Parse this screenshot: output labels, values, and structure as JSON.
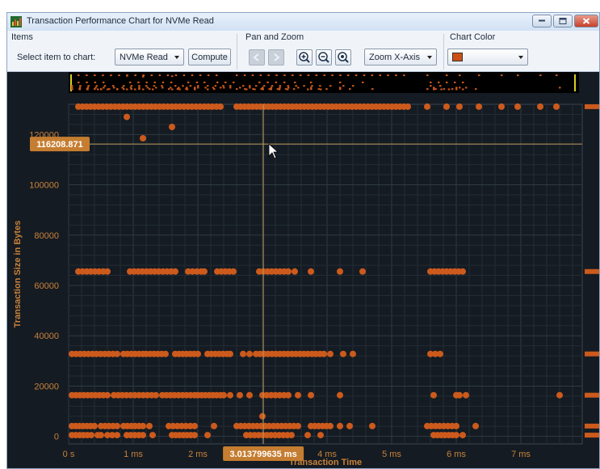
{
  "window": {
    "title": "Transaction Performance Chart for NVMe Read"
  },
  "toolbar": {
    "items_group": "Items",
    "select_label": "Select item to chart:",
    "item_value": "NVMe Read",
    "compute_label": "Compute",
    "panzoom_group": "Pan and Zoom",
    "zoom_axis_value": "Zoom X-Axis",
    "color_group": "Chart Color",
    "color_value": "#cc5016"
  },
  "icons": {
    "pan_left": "pan-left-icon",
    "pan_right": "pan-right-icon",
    "zoom_in": "zoom-in-icon",
    "zoom_out": "zoom-out-icon",
    "zoom_reset": "zoom-reset-icon"
  },
  "colors": {
    "point": "#cc5a1c",
    "axis_text": "#c8823a",
    "background": "#151b22",
    "grid": "#2e3a44",
    "cursor": "#b9985a",
    "tooltip": "#c57d31"
  },
  "chart_data": {
    "type": "scatter",
    "xlabel": "Transaction Time",
    "ylabel": "Transaction Size in Bytes",
    "xlim": [
      0,
      7.95
    ],
    "ylim": [
      -3000,
      132000
    ],
    "x_unit": "ms",
    "x_ticks": [
      0,
      1,
      2,
      3,
      4,
      5,
      6,
      7
    ],
    "x_tick_labels": [
      "0 s",
      "1 ms",
      "2 ms",
      "3 ms",
      "4 ms",
      "5 ms",
      "6 ms",
      "7 ms"
    ],
    "y_ticks": [
      0,
      20000,
      40000,
      60000,
      80000,
      100000,
      120000
    ],
    "y_tick_labels": [
      "0",
      "20000",
      "40000",
      "60000",
      "80000",
      "100000",
      "120000"
    ],
    "grid": true,
    "cursor": {
      "x": 3.013799635,
      "y": 116208.871,
      "x_label": "3.013799635 ms",
      "y_label": "116208.871"
    },
    "series": [
      {
        "bands": [
          {
            "y": 131072,
            "ranges": [
              [
                0.15,
                2.35
              ],
              [
                2.6,
                5.25
              ]
            ],
            "points": [
              5.55,
              5.85,
              6.05,
              6.35,
              6.7,
              6.95,
              7.3,
              7.55
            ]
          },
          {
            "y": 65536,
            "ranges": [
              [
                0.15,
                0.6
              ],
              [
                0.95,
                1.65
              ],
              [
                1.85,
                2.05
              ],
              [
                2.3,
                2.55
              ],
              [
                2.95,
                3.4
              ],
              [
                5.6,
                6.1
              ]
            ],
            "points": [
              2.1,
              3.5,
              3.75,
              4.2,
              4.55
            ]
          },
          {
            "y": 32768,
            "ranges": [
              [
                0.05,
                0.75
              ],
              [
                0.85,
                1.15
              ],
              [
                1.2,
                1.5
              ],
              [
                1.65,
                2.0
              ],
              [
                2.15,
                2.45
              ],
              [
                2.9,
                3.95
              ],
              [
                5.6,
                5.75
              ]
            ],
            "points": [
              2.5,
              2.7,
              2.8,
              4.05,
              4.25,
              4.4
            ]
          },
          {
            "y": 16384,
            "ranges": [
              [
                0.05,
                0.6
              ],
              [
                0.7,
                1.35
              ],
              [
                1.45,
                1.95
              ],
              [
                2.0,
                2.35
              ],
              [
                3.0,
                3.4
              ]
            ],
            "points": [
              2.4,
              2.5,
              2.65,
              2.8,
              3.55,
              3.75,
              4.2,
              5.65,
              6.0,
              6.05,
              6.15,
              7.6
            ]
          },
          {
            "y": 4096,
            "ranges": [
              [
                0.05,
                0.4
              ],
              [
                0.5,
                0.75
              ],
              [
                0.85,
                1.15
              ],
              [
                1.55,
                1.95
              ],
              [
                2.6,
                3.55
              ],
              [
                3.75,
                4.05
              ],
              [
                5.55,
                6.0
              ]
            ],
            "points": [
              1.25,
              2.25,
              4.2,
              4.35,
              4.7,
              6.3
            ]
          },
          {
            "y": 512,
            "ranges": [
              [
                0.05,
                0.35
              ],
              [
                0.6,
                0.75
              ],
              [
                0.9,
                1.15
              ],
              [
                1.6,
                1.95
              ],
              [
                2.75,
                3.45
              ],
              [
                5.65,
                6.0
              ]
            ],
            "points": [
              0.45,
              0.5,
              1.3,
              2.15,
              3.7,
              3.9,
              6.1
            ]
          }
        ],
        "extra_points": [
          [
            0.9,
            127000
          ],
          [
            1.15,
            118500
          ],
          [
            1.6,
            123000
          ],
          [
            3.0,
            8000
          ]
        ]
      }
    ]
  }
}
